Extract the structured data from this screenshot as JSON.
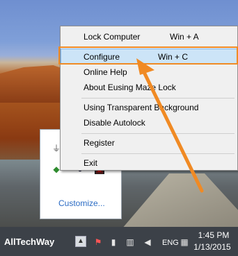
{
  "menu": {
    "items": [
      {
        "label": "Lock Computer",
        "shortcut": "Win + A"
      },
      {
        "label": "Configure",
        "shortcut": "Win + C"
      },
      {
        "label": "Online Help",
        "shortcut": ""
      },
      {
        "label": "About Eusing Maze Lock",
        "shortcut": ""
      },
      {
        "label": "Using Transparent Background",
        "shortcut": ""
      },
      {
        "label": "Disable Autolock",
        "shortcut": ""
      },
      {
        "label": "Register",
        "shortcut": ""
      },
      {
        "label": "Exit",
        "shortcut": ""
      }
    ],
    "highlight_color": "#cce4f7",
    "annotation_color": "#f08a24"
  },
  "tray_popup": {
    "customize_label": "Customize..."
  },
  "taskbar": {
    "brand": "AllTechWay",
    "language": "ENG",
    "time": "1:45 PM",
    "date": "1/13/2015"
  }
}
